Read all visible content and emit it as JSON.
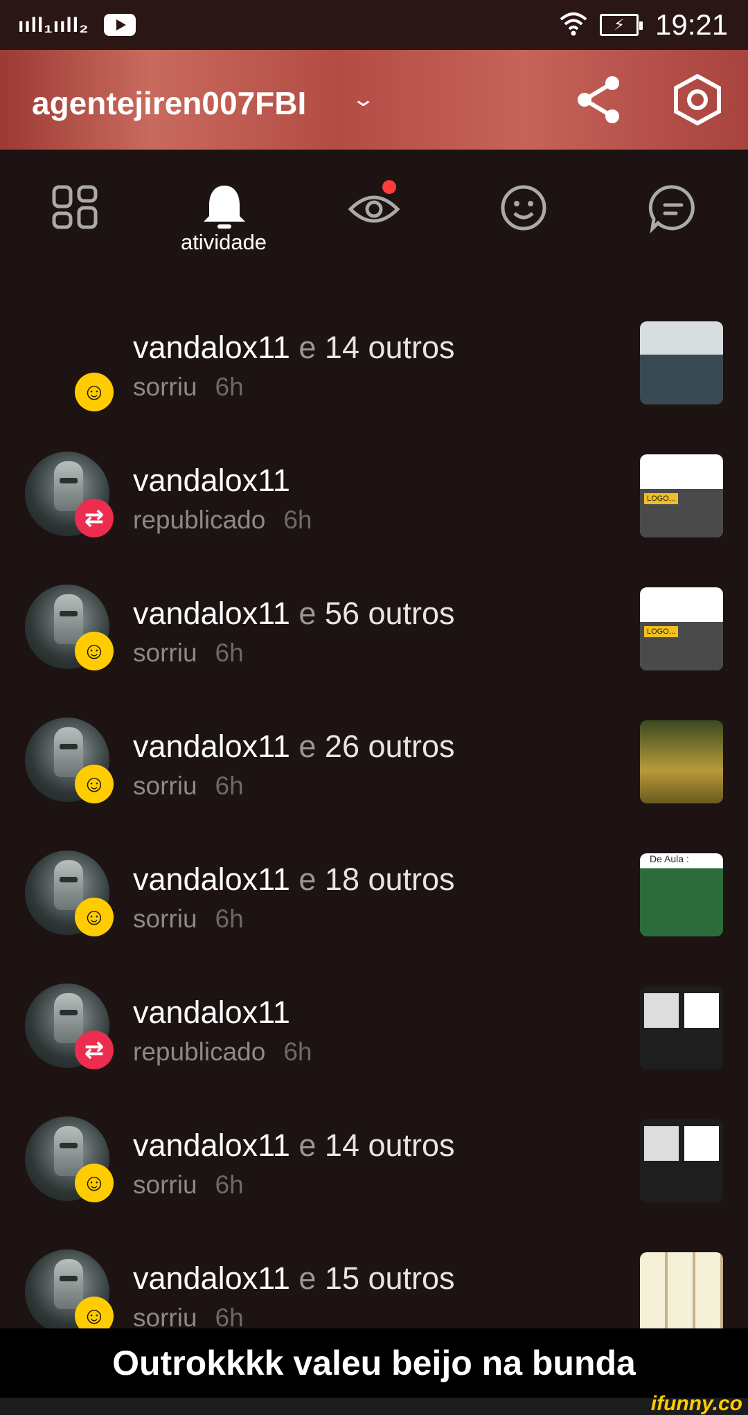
{
  "status_bar": {
    "signal": "ııll₁ııll₂",
    "time": "19:21"
  },
  "header": {
    "username": "agentejiren007FBI",
    "chevron": "⌵"
  },
  "tabs": [
    {
      "icon": "grid-icon"
    },
    {
      "icon": "bell-icon",
      "label": "atividade",
      "active": true
    },
    {
      "icon": "eye-icon",
      "has_notification_dot": true
    },
    {
      "icon": "smile-icon"
    },
    {
      "icon": "chat-icon"
    }
  ],
  "feed": [
    {
      "user": "vandalox11",
      "conj": "e",
      "others": "14 outros",
      "action": "sorriu",
      "time": "6h",
      "badge": "smile",
      "has_avatar": false
    },
    {
      "user": "vandalox11",
      "conj": "",
      "others": "",
      "action": "republicado",
      "time": "6h",
      "badge": "repub",
      "has_avatar": true
    },
    {
      "user": "vandalox11",
      "conj": "e",
      "others": "56 outros",
      "action": "sorriu",
      "time": "6h",
      "badge": "smile",
      "has_avatar": true
    },
    {
      "user": "vandalox11",
      "conj": "e",
      "others": "26 outros",
      "action": "sorriu",
      "time": "6h",
      "badge": "smile",
      "has_avatar": true
    },
    {
      "user": "vandalox11",
      "conj": "e",
      "others": "18 outros",
      "action": "sorriu",
      "time": "6h",
      "badge": "smile",
      "has_avatar": true
    },
    {
      "user": "vandalox11",
      "conj": "",
      "others": "",
      "action": "republicado",
      "time": "6h",
      "badge": "repub",
      "has_avatar": true
    },
    {
      "user": "vandalox11",
      "conj": "e",
      "others": "14 outros",
      "action": "sorriu",
      "time": "6h",
      "badge": "smile",
      "has_avatar": true
    },
    {
      "user": "vandalox11",
      "conj": "e",
      "others": "15 outros",
      "action": "sorriu",
      "time": "6h",
      "badge": "smile",
      "has_avatar": true
    }
  ],
  "caption": "Outrokkkk valeu beijo na bunda",
  "watermark": "ifunny.co",
  "colors": {
    "accent_red": "#ec2d4f",
    "smile_yellow": "#ffcc00",
    "background": "#1c1312"
  }
}
